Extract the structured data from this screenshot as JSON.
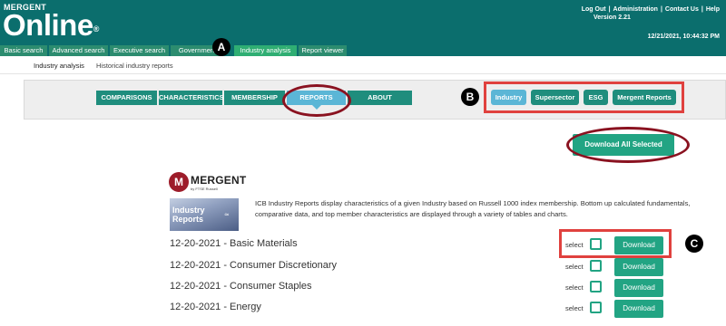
{
  "header": {
    "brand_top": "MERGENT",
    "brand_main": "Online",
    "brand_reg": "®",
    "links": [
      "Log Out",
      "Administration",
      "Contact Us",
      "Help"
    ],
    "version": "Version 2.21",
    "timestamp": "12/21/2021, 10:44:32 PM"
  },
  "tabs": [
    {
      "label": "Basic search",
      "active": false
    },
    {
      "label": "Advanced search",
      "active": false
    },
    {
      "label": "Executive search",
      "active": false
    },
    {
      "label": "Government",
      "active": false
    },
    {
      "label": "Industry analysis",
      "active": true
    },
    {
      "label": "Report viewer",
      "active": false
    }
  ],
  "subnav": [
    "Industry analysis",
    "Historical industry reports"
  ],
  "main_nav": [
    {
      "label": "COMPARISONS",
      "active": false
    },
    {
      "label": "CHARACTERISTICS",
      "active": false
    },
    {
      "label": "MEMBERSHIP",
      "active": false
    },
    {
      "label": "REPORTS",
      "active": true
    },
    {
      "label": "ABOUT",
      "active": false
    }
  ],
  "scope": [
    {
      "label": "Industry",
      "active": true
    },
    {
      "label": "Supersector",
      "active": false
    },
    {
      "label": "ESG",
      "active": false
    },
    {
      "label": "Mergent Reports",
      "active": false
    }
  ],
  "download_all": "Download All Selected",
  "logo": {
    "mark": "M",
    "text": "MERGENT",
    "sub": "by FTSE Russell"
  },
  "thumb": {
    "line1": "Industry",
    "line2": "Reports"
  },
  "description": "ICB Industry Reports display characteristics of a given Industry based on Russell 1000 index membership. Bottom up calculated fundamentals, comparative data, and top member characteristics are displayed through a variety of tables and charts.",
  "rows": [
    {
      "title": "12-20-2021 - Basic Materials",
      "select": "select",
      "download": "Download"
    },
    {
      "title": "12-20-2021 - Consumer Discretionary",
      "select": "select",
      "download": "Download"
    },
    {
      "title": "12-20-2021 - Consumer Staples",
      "select": "select",
      "download": "Download"
    },
    {
      "title": "12-20-2021 - Energy",
      "select": "select",
      "download": "Download"
    }
  ],
  "annotations": [
    "A",
    "B",
    "C"
  ],
  "colors": {
    "header": "#0b6e6d",
    "accent": "#22a483",
    "active": "#5bb6d6",
    "annotation_ellipse": "#8a1220",
    "annotation_box": "#e0413e"
  }
}
